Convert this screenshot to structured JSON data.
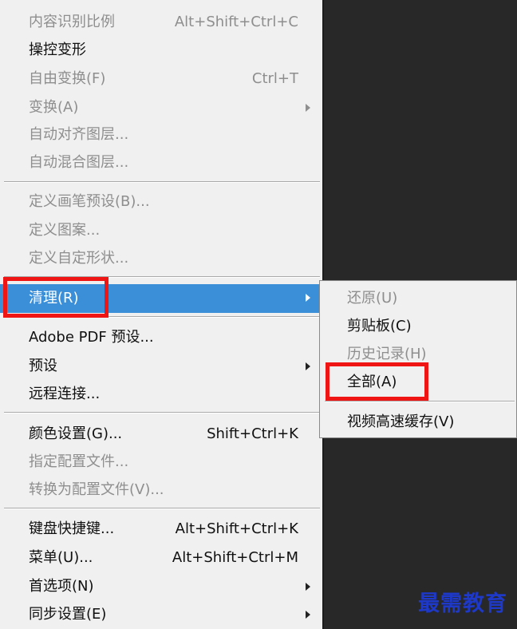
{
  "menu": {
    "items": [
      {
        "label": "内容识别比例",
        "shortcut": "Alt+Shift+Ctrl+C"
      },
      {
        "label": "操控变形",
        "shortcut": ""
      },
      {
        "label": "自由变换(F)",
        "shortcut": "Ctrl+T"
      },
      {
        "label": "变换(A)",
        "shortcut": ""
      },
      {
        "label": "自动对齐图层...",
        "shortcut": ""
      },
      {
        "label": "自动混合图层...",
        "shortcut": ""
      },
      {
        "label": "定义画笔预设(B)...",
        "shortcut": ""
      },
      {
        "label": "定义图案...",
        "shortcut": ""
      },
      {
        "label": "定义自定形状...",
        "shortcut": ""
      },
      {
        "label": "清理(R)",
        "shortcut": ""
      },
      {
        "label": "Adobe PDF 预设...",
        "shortcut": ""
      },
      {
        "label": "预设",
        "shortcut": ""
      },
      {
        "label": "远程连接...",
        "shortcut": ""
      },
      {
        "label": "颜色设置(G)...",
        "shortcut": "Shift+Ctrl+K"
      },
      {
        "label": "指定配置文件...",
        "shortcut": ""
      },
      {
        "label": "转换为配置文件(V)...",
        "shortcut": ""
      },
      {
        "label": "键盘快捷键...",
        "shortcut": "Alt+Shift+Ctrl+K"
      },
      {
        "label": "菜单(U)...",
        "shortcut": "Alt+Shift+Ctrl+M"
      },
      {
        "label": "首选项(N)",
        "shortcut": ""
      },
      {
        "label": "同步设置(E)",
        "shortcut": ""
      }
    ]
  },
  "submenu": {
    "items": [
      {
        "label": "还原(U)"
      },
      {
        "label": "剪贴板(C)"
      },
      {
        "label": "历史记录(H)"
      },
      {
        "label": "全部(A)"
      },
      {
        "label": "视频高速缓存(V)"
      }
    ]
  },
  "watermark": "最需教育",
  "colors": {
    "highlight": "#3b8fd9",
    "annotation_red": "#f01515",
    "watermark": "#1e38c8"
  }
}
